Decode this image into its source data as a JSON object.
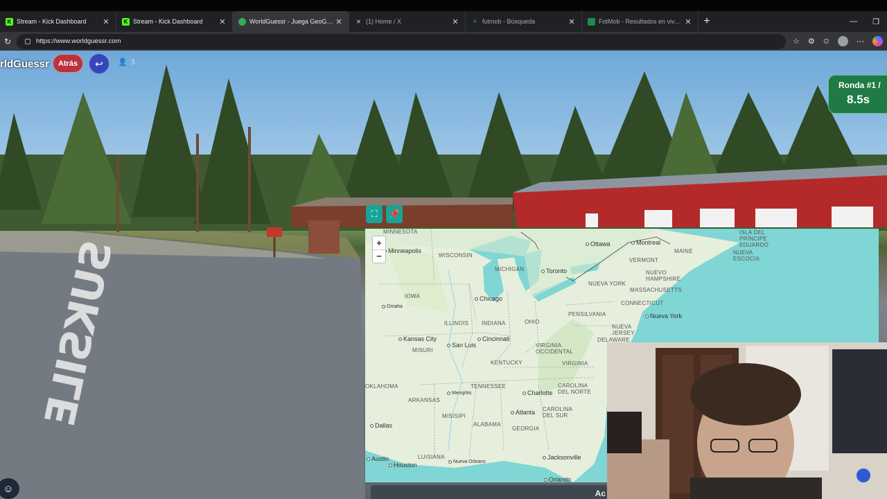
{
  "browser": {
    "tabs": [
      {
        "title": "Stream - Kick Dashboard",
        "icon": "kick-icon",
        "active": false
      },
      {
        "title": "Stream - Kick Dashboard",
        "icon": "kick-icon",
        "active": false
      },
      {
        "title": "WorldGuessr - Juega GeoGuessr g",
        "icon": "globe-icon",
        "active": true
      },
      {
        "title": "(1) Home / X",
        "icon": "x-icon",
        "active": false
      },
      {
        "title": "futmob - Búsqueda",
        "icon": "search-icon",
        "active": false
      },
      {
        "title": "FotMob - Resultados en vivo de fú",
        "icon": "fotmob-icon",
        "active": false
      }
    ],
    "new_tab": "+",
    "url": "https://www.worldguessr.com"
  },
  "game": {
    "logo": "rldGuessr",
    "back_label": "Atrás",
    "players_count": "3",
    "round_label": "Ronda #1 /",
    "timer": "8.5s",
    "road_text": "SUKSILE"
  },
  "map": {
    "zoom_in": "+",
    "zoom_out": "−",
    "regions": [
      "MINNESOTA",
      "WISCONSIN",
      "MICHIGAN",
      "IOWA",
      "ILLINOIS",
      "INDIANA",
      "OHIO",
      "PENSILVANIA",
      "NUEVA YORK",
      "VERMONT",
      "MAINE",
      "NUEVO HAMPSHIRE",
      "MASSACHUSETTS",
      "CONNECTICUT",
      "NUEVA JERSEY",
      "DELAWARE",
      "MISURI",
      "KENTUCKY",
      "VIRGINIA OCCIDENTAL",
      "VIRGINIA",
      "TENNESSEE",
      "CAROLINA DEL NORTE",
      "CAROLINA DEL SUR",
      "ARKANSAS",
      "MISISIPI",
      "ALABAMA",
      "GEORGIA",
      "LUISIANA",
      "OKLAHOMA",
      "ISLA DEL PRÍNCIPE EDUARDO",
      "NUEVA ESCOCIA"
    ],
    "cities": [
      "Minneapolis",
      "Ottawa",
      "Montreal",
      "Toronto",
      "Chicago",
      "Omaha",
      "Kansas City",
      "San Luis",
      "Cincinnati",
      "Nueva York",
      "Memphis",
      "Charlotte",
      "Atlanta",
      "Dallas",
      "Austin",
      "Houston",
      "Nueva Orleans",
      "Jacksonville",
      "Orlando"
    ]
  },
  "colors": {
    "round_bg": "#1f7a46",
    "back_btn": "#b8333c",
    "return_btn": "#3446b8",
    "map_tool": "#17a39a",
    "water": "#7fd6d4",
    "land": "#e9f2df"
  }
}
